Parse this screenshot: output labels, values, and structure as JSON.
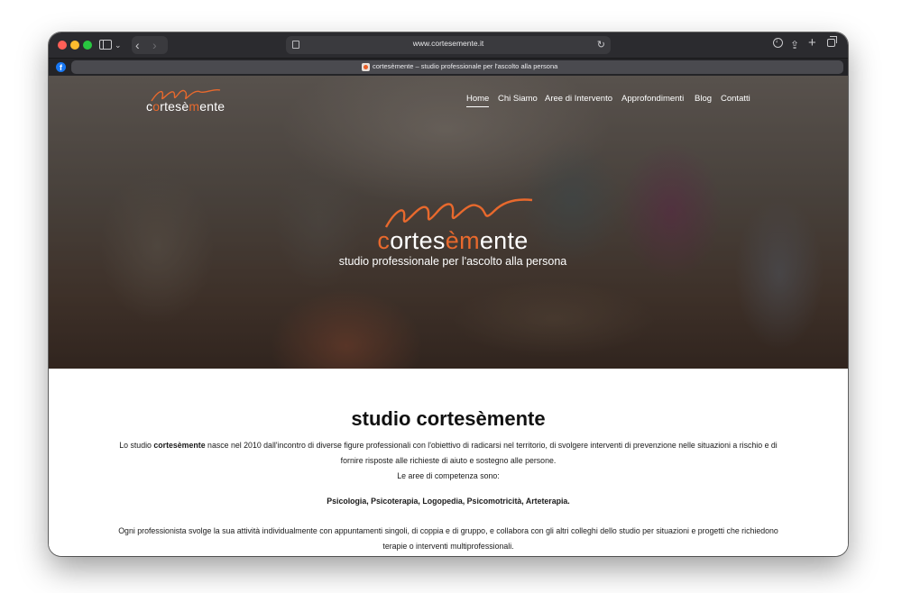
{
  "browser": {
    "url": "www.cortesemente.it",
    "tab_title": "cortesèmente – studio professionale per l'ascolto alla persona",
    "pinned_tab_letter": "f",
    "icons": {
      "sidebar": "sidebar-icon",
      "back": "‹",
      "forward": "›",
      "chevron": "⌄",
      "reload": "↻",
      "share": "⇪",
      "new_tab": "+"
    }
  },
  "site": {
    "brand_prefix": "c",
    "brand_o": "o",
    "brand_mid": "rtes",
    "brand_e": "è",
    "brand_m": "m",
    "brand_suffix": "ente",
    "accent_color": "#e8692d",
    "nav": [
      "Home",
      "Chi Siamo",
      "Aree di Intervento",
      "Approfondimenti",
      "Blog",
      "Contatti"
    ],
    "tagline": "studio professionale per l'ascolto alla persona"
  },
  "content": {
    "heading": "studio cortesèmente",
    "intro_before": "Lo studio ",
    "intro_bold": "cortesèmente",
    "intro_after": " nasce nel 2010 dall'incontro di diverse figure professionali con l'obiettivo di radicarsi nel territorio, di svolgere interventi di prevenzione nelle situazioni a rischio e di fornire risposte alle richieste di aiuto e sostegno alle persone.",
    "areas_label": "Le aree di competenza sono:",
    "areas_list": "Psicologia, Psicoterapia, Logopedia, Psicomotricità, Arteterapia.",
    "closing": "Ogni professionista svolge la sua attività individualmente con appuntamenti singoli, di coppia e di gruppo, e collabora con gli altri colleghi dello studio per situazioni e progetti che richiedono terapie o interventi multiprofessionali."
  }
}
